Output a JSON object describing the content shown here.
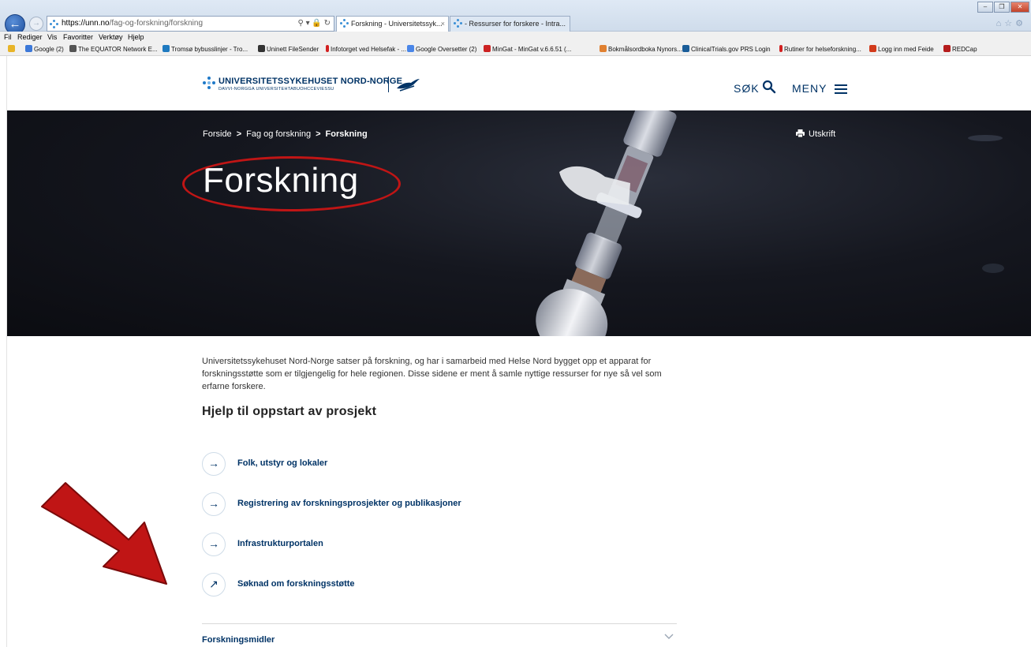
{
  "browser": {
    "url_host": "https://unn.no",
    "url_path": "/fag-og-forskning/forskning",
    "tabs": [
      {
        "label": "Forskning - Universitetssyk...",
        "close": "×"
      },
      {
        "label": "- Ressurser for forskere - Intra..."
      }
    ],
    "menu": [
      "Fil",
      "Rediger",
      "Vis",
      "Favoritter",
      "Verktøy",
      "Hjelp"
    ],
    "favorites": [
      {
        "label": "Google (2)",
        "color": "#3c78d8"
      },
      {
        "label": "The EQUATOR Network E...",
        "color": "#555555"
      },
      {
        "label": "Tromsø bybusslinjer - Tro...",
        "color": "#1f7ac0"
      },
      {
        "label": "Uninett FileSender",
        "color": "#333333"
      },
      {
        "label": "Infotorget ved Helsefak - ...",
        "color": "#d22020"
      },
      {
        "label": "Google Oversetter (2)",
        "color": "#4a86e8"
      },
      {
        "label": "MinGat - MinGat v.6.6.51 (...",
        "color": "#cc2222"
      },
      {
        "label": "Bokmålsordboka Nynors...",
        "color": "#e08030"
      },
      {
        "label": "ClinicalTrials.gov PRS Login",
        "color": "#1a5d99"
      },
      {
        "label": "Rutiner for helseforskning...",
        "color": "#d22020"
      },
      {
        "label": "Logg inn med Feide",
        "color": "#d23a1a"
      },
      {
        "label": "REDCap",
        "color": "#b51c1c"
      }
    ]
  },
  "header": {
    "logo_title": "UNIVERSITETSSYKEHUSET NORD-NORGE",
    "logo_subtitle": "DAVVI-NORGGA UNIVERSITEHTABUOHCCEVIESSU",
    "search_label": "SØK",
    "menu_label": "MENY"
  },
  "hero": {
    "breadcrumb": [
      "Forside",
      "Fag og forskning",
      "Forskning"
    ],
    "breadcrumb_sep": ">",
    "print_label": "Utskrift",
    "title": "Forskning"
  },
  "content": {
    "intro": "Universitetssykehuset Nord-Norge satser på forskning, og har i samarbeid med Helse Nord bygget opp et apparat for forskningsstøtte som er tilgjengelig for hele regionen. Disse sidene er ment å samle nyttige ressurser for nye så vel som erfarne forskere.",
    "section_heading": "Hjelp til oppstart av prosjekt",
    "links": [
      {
        "label": "Folk, utstyr og lokaler",
        "icon": "arrow-right-icon",
        "glyph": "→"
      },
      {
        "label": "Registrering av forskningsprosjekter og publikasjoner",
        "icon": "arrow-right-icon",
        "glyph": "→"
      },
      {
        "label": "Infrastrukturportalen",
        "icon": "arrow-right-icon",
        "glyph": "→"
      },
      {
        "label": "Søknad om forskningsstøtte",
        "icon": "external-link-icon",
        "glyph": "↗"
      }
    ],
    "accordion_label": "Forskningsmidler"
  },
  "annotations": {
    "circle_color": "#c01515",
    "arrow_color": "#c01515"
  }
}
